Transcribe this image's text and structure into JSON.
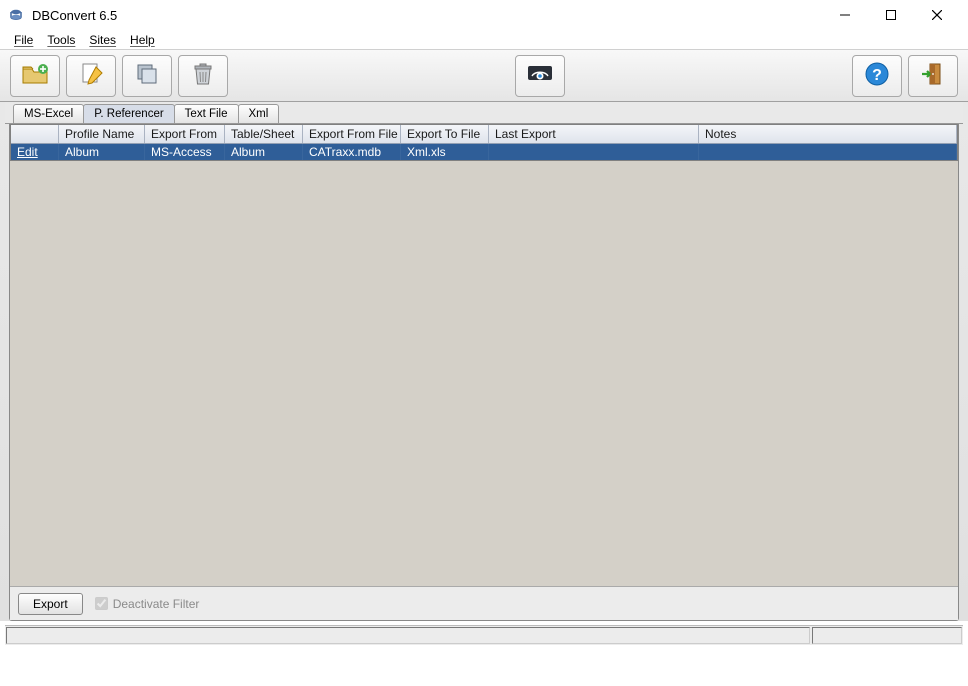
{
  "window": {
    "title": "DBConvert 6.5"
  },
  "menu": {
    "file": "File",
    "tools": "Tools",
    "sites": "Sites",
    "help": "Help"
  },
  "toolbar": {
    "new": "New profile",
    "edit": "Edit profile",
    "copy": "Copy profile",
    "delete": "Delete profile",
    "preview": "Preview",
    "help": "Help",
    "exit": "Exit"
  },
  "tabs": {
    "msexcel": "MS-Excel",
    "preferencer": "P. Referencer",
    "textfile": "Text File",
    "xml": "Xml"
  },
  "columns": {
    "profile_name": "Profile Name",
    "export_from": "Export From",
    "table_sheet": "Table/Sheet",
    "export_from_file": "Export From File",
    "export_to_file": "Export To File",
    "last_export": "Last Export",
    "notes": "Notes"
  },
  "row": {
    "action": "Edit",
    "profile_name": "Album",
    "export_from": "MS-Access",
    "table_sheet": "Album",
    "export_from_file": "CATraxx.mdb",
    "export_to_file": "Xml.xls",
    "last_export": "",
    "notes": ""
  },
  "bottom": {
    "export": "Export",
    "deactivate_filter": "Deactivate Filter"
  }
}
